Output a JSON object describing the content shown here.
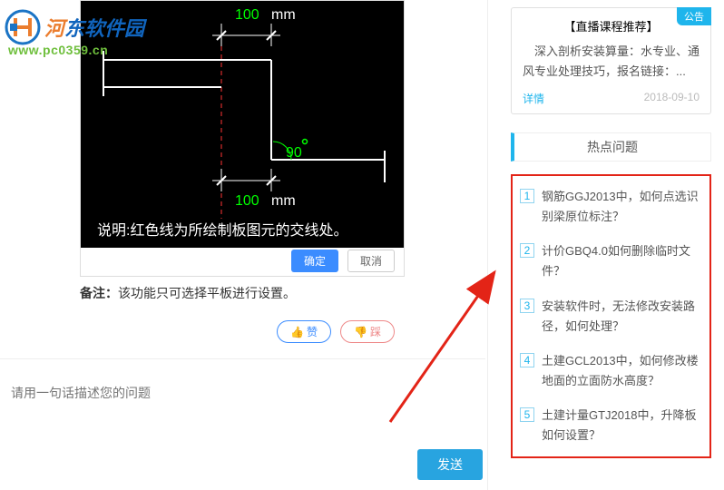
{
  "logo": {
    "text_parts": [
      "河",
      "东",
      "软件园"
    ],
    "url": "www.pc0359.cn"
  },
  "diagram": {
    "label_top": "100",
    "label_top_unit": "mm",
    "label_angle": "90",
    "label_bottom": "100",
    "label_bottom_unit": "mm",
    "caption": "说明:红色线为所绘制板图元的交线处。",
    "confirm": "确定",
    "cancel": "取消"
  },
  "remark": {
    "label": "备注：",
    "text": "该功能只可选择平板进行设置。"
  },
  "like": {
    "like_label": "赞",
    "dislike_label": "踩"
  },
  "input": {
    "placeholder": "请用一句话描述您的问题"
  },
  "send": {
    "label": "发送"
  },
  "notice": {
    "badge": "公告",
    "title": "【直播课程推荐】",
    "body": "深入剖析安装算量：水专业、通风专业处理技巧，报名链接：...",
    "link": "详情",
    "date": "2018-09-10"
  },
  "hot": {
    "header": "热点问题",
    "items": [
      "钢筋GGJ2013中，如何点选识别梁原位标注？",
      "计价GBQ4.0如何删除临时文件？",
      "安装软件时，无法修改安装路径，如何处理？",
      "土建GCL2013中，如何修改楼地面的立面防水高度？",
      "土建计量GTJ2018中，升降板如何设置？"
    ]
  }
}
